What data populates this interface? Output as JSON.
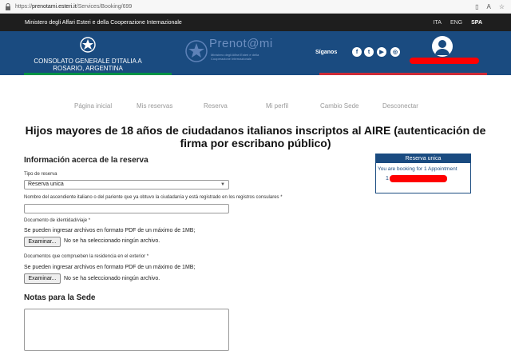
{
  "browser": {
    "url_prefix": "https://",
    "url_host": "prenotami.esteri.it",
    "url_path": "/Services/Booking/699"
  },
  "topbar": {
    "ministry": "Ministero degli Affari Esteri e della Cooperazione Internazionale",
    "langs": [
      "ITA",
      "ENG",
      "SPA"
    ],
    "active_lang": "SPA"
  },
  "header": {
    "consolato_line1": "CONSOLATO GENERALE D'ITALIA A",
    "consolato_line2": "ROSARIO, ARGENTINA",
    "logo_text": "Prenot@mi",
    "logo_sub": "Ministero degli Affari Esteri e della Cooperazione Internazionale",
    "seguinos": "Síganos",
    "social_icons": [
      "facebook-icon",
      "twitter-icon",
      "youtube-icon",
      "instagram-icon"
    ]
  },
  "colors": {
    "blue": "#1a4b80",
    "dark": "#1e1e1e",
    "green": "#009246",
    "red": "#ce2b37"
  },
  "nav": [
    "Página inicial",
    "Mis reservas",
    "Reserva",
    "Mi perfil",
    "Cambio Sede",
    "Desconectar"
  ],
  "main": {
    "title": "Hijos mayores de 18 años de ciudadanos italianos inscriptos al AIRE (autenticación de firma por escribano público)",
    "info_heading": "Información acerca de la reserva",
    "tipo_label": "Tipo de reserva",
    "tipo_value": "Reserva unica",
    "ascendiente_label": "Nombre del ascendiente italiano o del pariente que ya obtuvo la ciudadanía y está registrado en los registros consulares *",
    "doc_label": "Documento de identidad/viaje *",
    "doc_note": "Se pueden ingresar archivos en formato PDF de un máximo de 1MB;",
    "browse_label": "Examinar...",
    "no_file": "No se ha seleccionado ningún archivo.",
    "residencia_label": "Documentos que comprueben la residencia en el exterior *",
    "residencia_note": "Se pueden ingresar archivos en formato PDF de un máximo de 1MB;",
    "notas_heading": "Notas para la Sede"
  },
  "panel": {
    "title": "Reserva unica",
    "line": "You are booking for 1 Appointment",
    "num": "1"
  }
}
